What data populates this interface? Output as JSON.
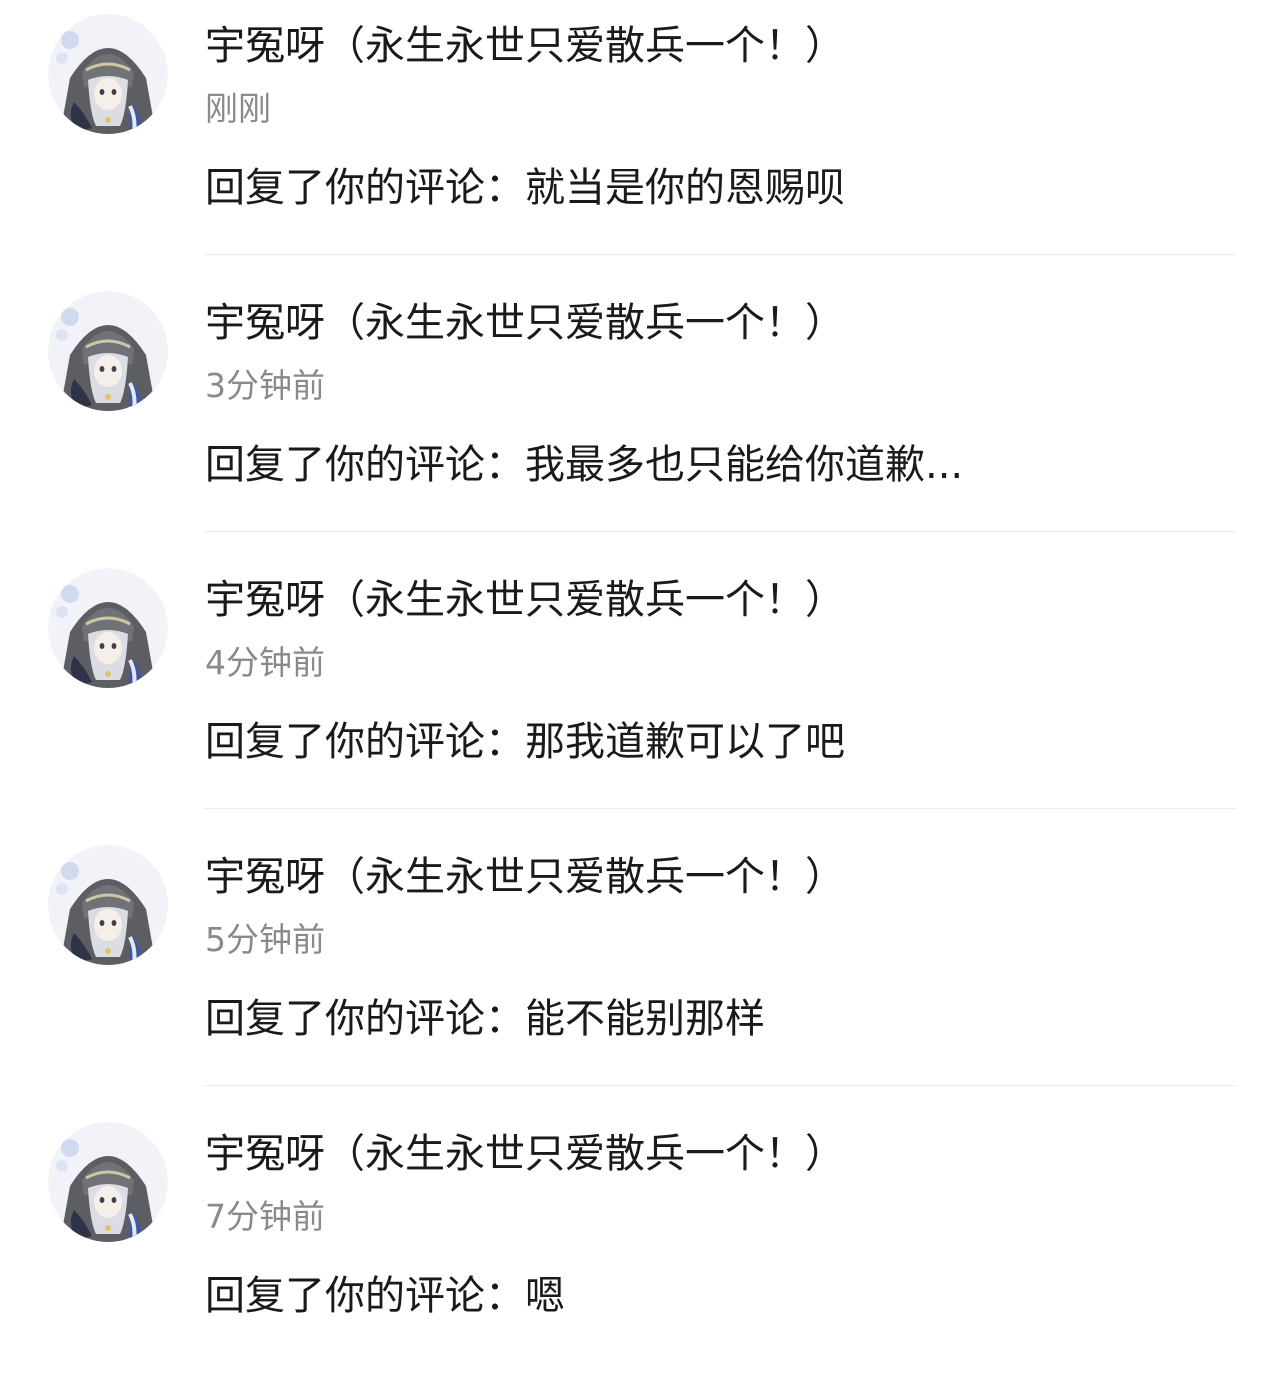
{
  "notifications": [
    {
      "username": "宇冤呀（永生永世只爱散兵一个！）",
      "time": "刚刚",
      "reply_prefix": "回复了你的评论：",
      "reply_text": "就当是你的恩赐呗",
      "avatar_icon": "anime-avatar-icon"
    },
    {
      "username": "宇冤呀（永生永世只爱散兵一个！）",
      "time": "3分钟前",
      "reply_prefix": "回复了你的评论：",
      "reply_text": "我最多也只能给你道歉...",
      "avatar_icon": "anime-avatar-icon"
    },
    {
      "username": "宇冤呀（永生永世只爱散兵一个！）",
      "time": "4分钟前",
      "reply_prefix": "回复了你的评论：",
      "reply_text": "那我道歉可以了吧",
      "avatar_icon": "anime-avatar-icon"
    },
    {
      "username": "宇冤呀（永生永世只爱散兵一个！）",
      "time": "5分钟前",
      "reply_prefix": "回复了你的评论：",
      "reply_text": "能不能别那样",
      "avatar_icon": "anime-avatar-icon"
    },
    {
      "username": "宇冤呀（永生永世只爱散兵一个！）",
      "time": "7分钟前",
      "reply_prefix": "回复了你的评论：",
      "reply_text": "嗯",
      "avatar_icon": "anime-avatar-icon"
    }
  ],
  "colors": {
    "text_primary": "#1a1a1a",
    "text_secondary": "#8a8a8a",
    "divider": "#ececec",
    "background": "#ffffff"
  }
}
